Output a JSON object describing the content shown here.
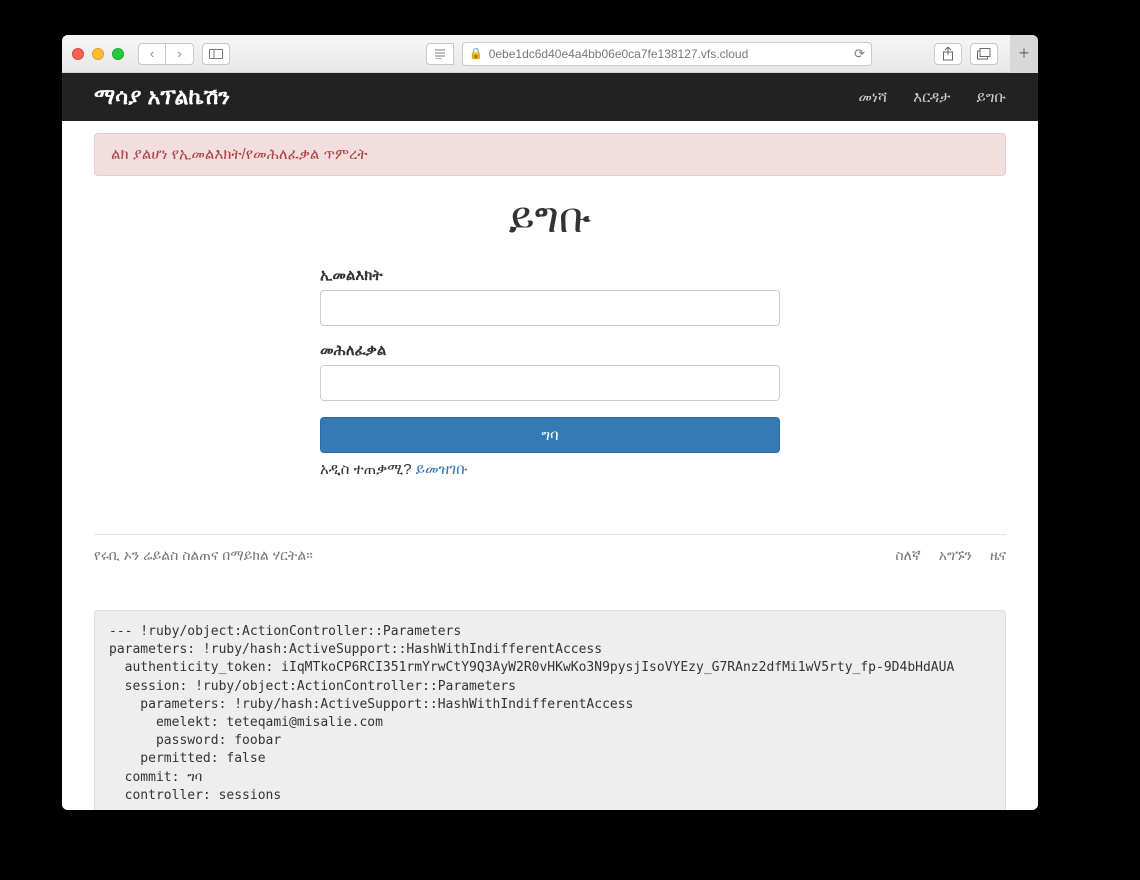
{
  "browser": {
    "url": "0ebe1dc6d40e4a4bb06e0ca7fe138127.vfs.cloud"
  },
  "navbar": {
    "brand": "ማሳያ አፕልኬሽን",
    "links": [
      "መነሻ",
      "እርዳታ",
      "ይግቡ"
    ]
  },
  "alert": {
    "message": "ልክ ያልሆነ የኢመልእክት/የመሕለፈቃል ጥምረት"
  },
  "page": {
    "title": "ይግቡ"
  },
  "form": {
    "email_label": "ኢመልእክት",
    "password_label": "መሕለፈቃል",
    "submit_label": "ግባ",
    "signup_prompt": "አዲስ ተጠቃሚ?",
    "signup_link": "ይመዝገቡ"
  },
  "footer": {
    "text": "የሩቢ ኦን ሬይልስ ስልጠና በማይክል ሃርትል፡፡",
    "links": [
      "ስለኛ",
      "አግኙን",
      "ዜና"
    ]
  },
  "debug": {
    "text": "--- !ruby/object:ActionController::Parameters\nparameters: !ruby/hash:ActiveSupport::HashWithIndifferentAccess\n  authenticity_token: iIqMTkoCP6RCI351rmYrwCtY9Q3AyW2R0vHKwKo3N9pysjIsoVYEzy_G7RAnz2dfMi1wV5rty_fp-9D4bHdAUA\n  session: !ruby/object:ActionController::Parameters\n    parameters: !ruby/hash:ActiveSupport::HashWithIndifferentAccess\n      emelekt: teteqami@misalie.com\n      password: foobar\n    permitted: false\n  commit: ግባ\n  controller: sessions"
  }
}
